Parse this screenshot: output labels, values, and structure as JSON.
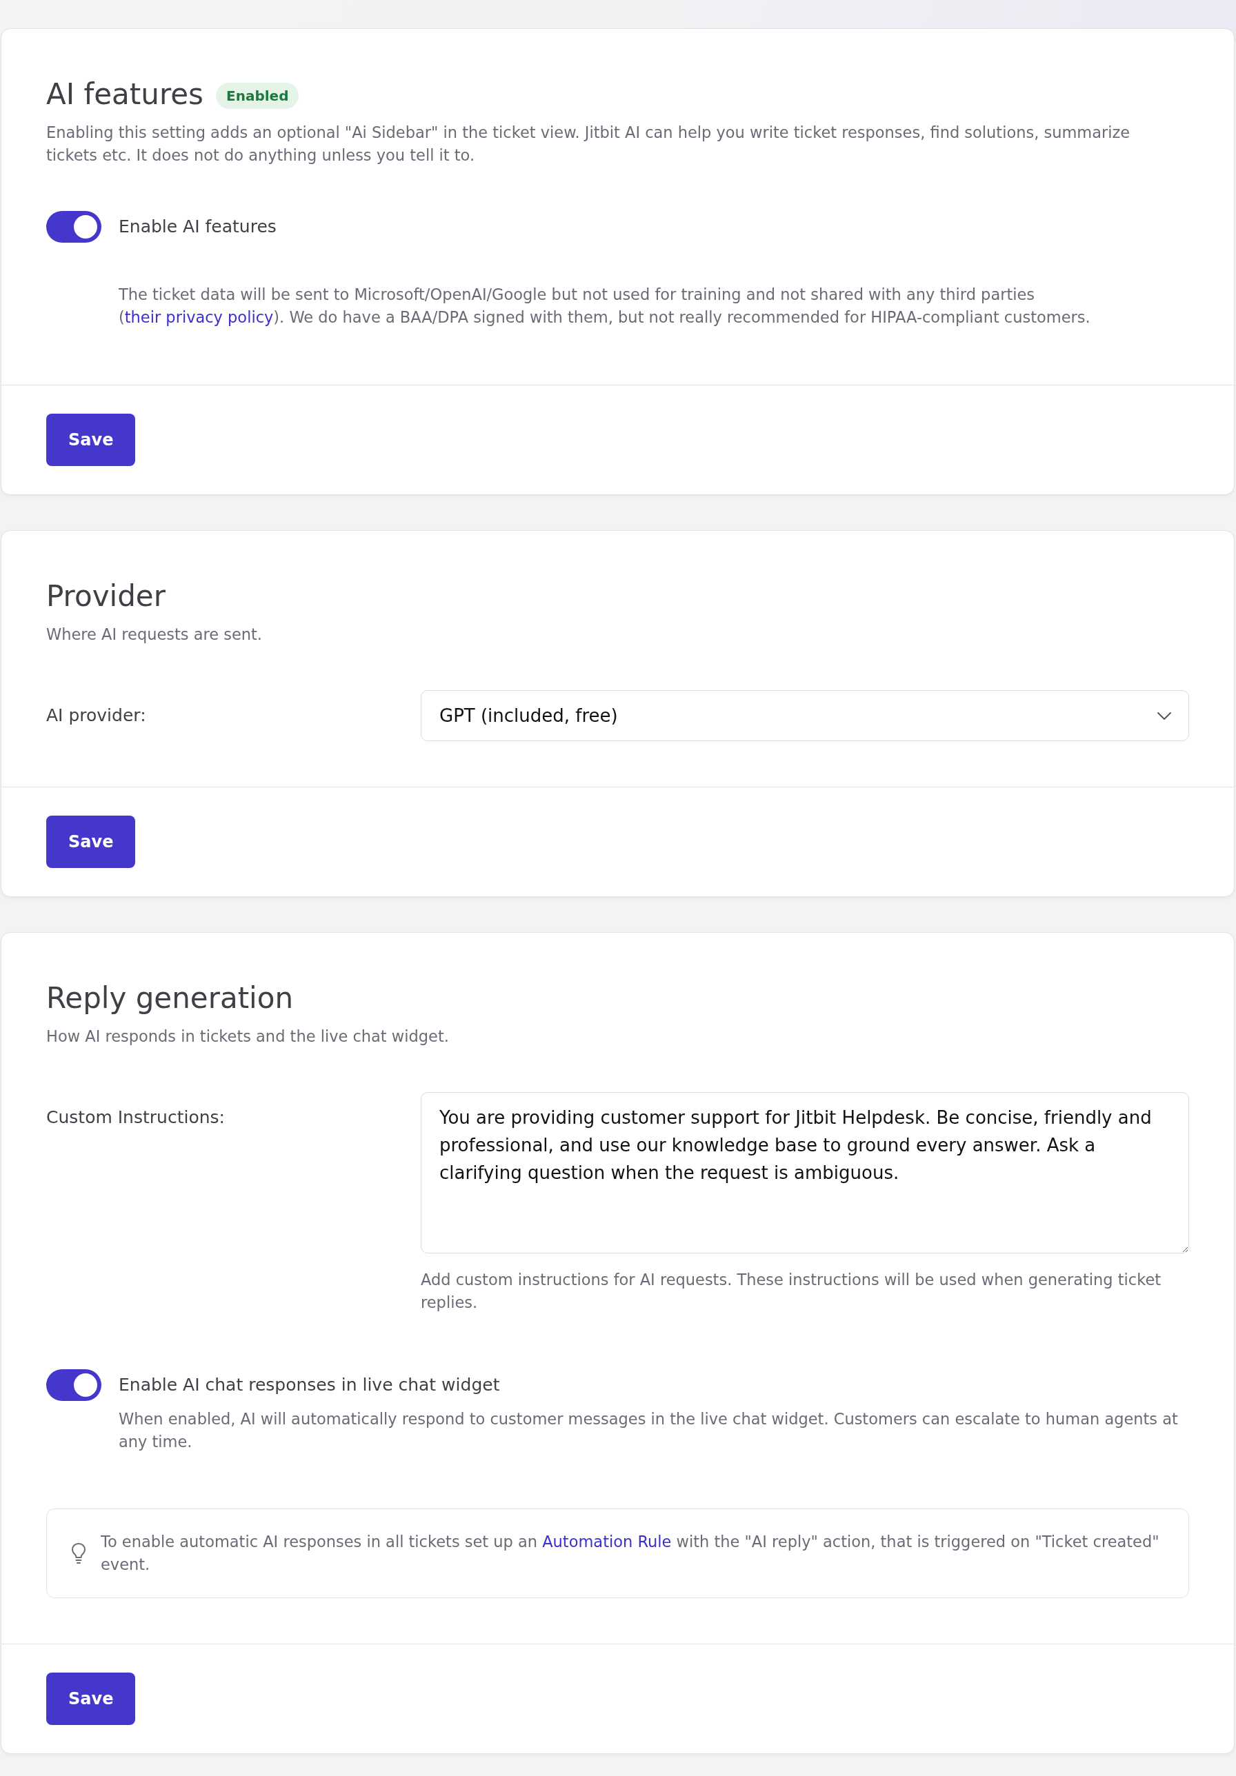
{
  "sections": [
    {
      "title": "AI features",
      "badge": "Enabled",
      "description": "Enabling this setting adds an optional \"Ai Sidebar\" in the ticket view. Jitbit AI can help you write ticket responses, find solutions, summarize tickets etc. It does not do anything unless you tell it to.",
      "fields": [
        {
          "kind": "toggle",
          "label": "Enable AI features",
          "on": true
        },
        {
          "kind": "note",
          "text_before": "The ticket data will be sent to Microsoft/OpenAI/Google but not used for training and not shared with any third parties (",
          "link": "their privacy policy",
          "text_after": "). We do have a BAA/DPA signed with them, but not really recommended for HIPAA-compliant customers."
        }
      ],
      "button": "Save"
    },
    {
      "title": "Provider",
      "description": "Where AI requests are sent.",
      "fields": [
        {
          "kind": "select",
          "label": "AI provider:",
          "value": "GPT (included, free)"
        }
      ],
      "button": "Save"
    },
    {
      "title": "Reply generation",
      "description": "How AI responds in tickets and the live chat widget.",
      "fields": [
        {
          "kind": "textarea",
          "label": "Custom Instructions:",
          "value": "You are providing customer support for Jitbit Helpdesk. Be concise, friendly and professional, and use our knowledge base to ground every answer. Ask a clarifying question when the request is ambiguous.",
          "help": "Add custom instructions for AI requests. These instructions will be used when generating ticket replies."
        },
        {
          "kind": "toggle",
          "label": "Enable AI chat responses in live chat widget",
          "on": true,
          "description": "When enabled, AI will automatically respond to customer messages in the live chat widget. Customers can escalate to human agents at any time."
        },
        {
          "kind": "tip",
          "text_before": "To enable automatic AI responses in all tickets set up an ",
          "link": "Automation Rule",
          "text_after": " with the \"AI reply\" action, that is triggered on \"Ticket created\" event."
        }
      ],
      "button": "Save"
    }
  ]
}
